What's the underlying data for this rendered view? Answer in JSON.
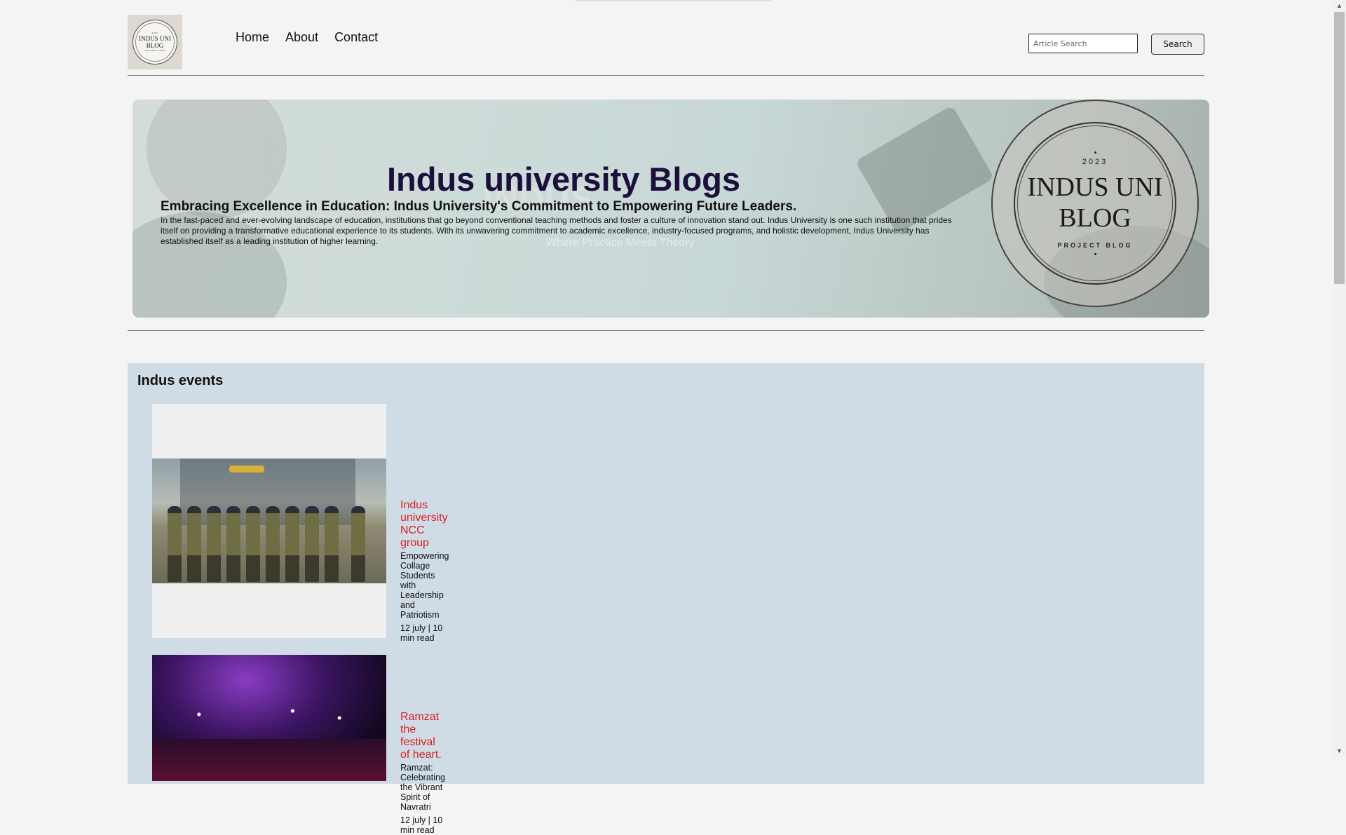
{
  "logo": {
    "line0": "2023",
    "line1": "INDUS UNI",
    "line2": "BLOG",
    "line3": "PROJECT BLOG"
  },
  "nav": {
    "home": "Home",
    "about": "About",
    "contact": "Contact"
  },
  "search": {
    "placeholder": "Article Search",
    "button_label": "Search"
  },
  "hero": {
    "title": "Indus university Blogs",
    "subtitle": "Embracing Excellence in Education: Indus University's Commitment to Empowering Future Leaders.",
    "body": "In the fast-paced and ever-evolving landscape of education, institutions that go beyond conventional teaching methods and foster a culture of innovation stand out. Indus University is one such institution that prides itself on providing a transformative educational experience to its students. With its unwavering commitment to academic excellence, industry-focused programs, and holistic development, Indus University has established itself as a leading institution of higher learning.",
    "background_text": "INDUS",
    "background_tagline": "Where Practice Meets Theory",
    "badge": {
      "year": "2023",
      "name_line1": "INDUS UNI",
      "name_line2": "BLOG",
      "tagline": "PROJECT BLOG"
    }
  },
  "events": {
    "heading": "Indus events",
    "items": [
      {
        "title": "Indus university NCC group",
        "description": "Empowering Collage Students with Leadership and Patriotism",
        "meta": "12 july | 10 min read"
      },
      {
        "title": "Ramzat the festival of heart.",
        "description": "Ramzat: Celebrating the Vibrant Spirit of Navratri",
        "meta": "12 july | 10 min read"
      }
    ]
  },
  "colors": {
    "event_title": "#d62222",
    "hero_title": "#1c0f3c",
    "events_bg": "#cfdce6",
    "page_bg": "#f4f4f4"
  }
}
